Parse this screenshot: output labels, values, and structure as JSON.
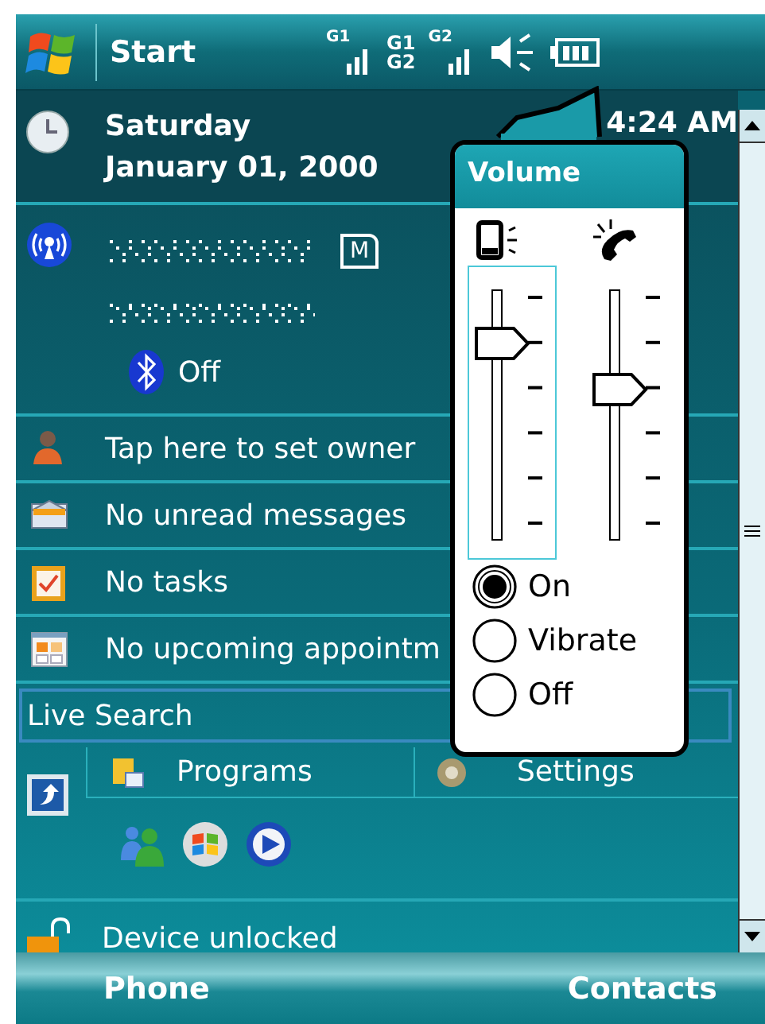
{
  "title_bar": {
    "start": "Start",
    "status_icons": [
      {
        "kind": "signal",
        "text": "G1"
      },
      {
        "kind": "dual",
        "text": "G1",
        "text2": "G2"
      },
      {
        "kind": "signal",
        "text": "G2"
      },
      {
        "kind": "speaker"
      },
      {
        "kind": "battery"
      }
    ]
  },
  "date": {
    "day": "Saturday",
    "date": "January 01, 2000",
    "time": "4:24 AM"
  },
  "connection": {
    "sim_label": "M",
    "bluetooth": "Off"
  },
  "items": [
    {
      "kind": "owner",
      "text": "Tap here to set owner"
    },
    {
      "kind": "messages",
      "text": "No unread messages"
    },
    {
      "kind": "tasks",
      "text": "No tasks"
    },
    {
      "kind": "calendar",
      "text": "No upcoming appointm"
    }
  ],
  "search": {
    "placeholder": "Live Search"
  },
  "shortcuts": [
    {
      "kind": "programs",
      "label": "Programs"
    },
    {
      "kind": "settings",
      "label": "Settings"
    }
  ],
  "lock": {
    "text": "Device unlocked"
  },
  "softkeys": [
    "Phone",
    "Contacts"
  ],
  "volume": {
    "title": "Volume",
    "sliders": [
      {
        "kind": "device",
        "level": 0.8,
        "selected": true
      },
      {
        "kind": "ringer",
        "level": 0.6,
        "selected": false
      }
    ],
    "options": [
      {
        "label": "On",
        "selected": true
      },
      {
        "label": "Vibrate",
        "selected": false
      },
      {
        "label": "Off",
        "selected": false
      }
    ]
  }
}
